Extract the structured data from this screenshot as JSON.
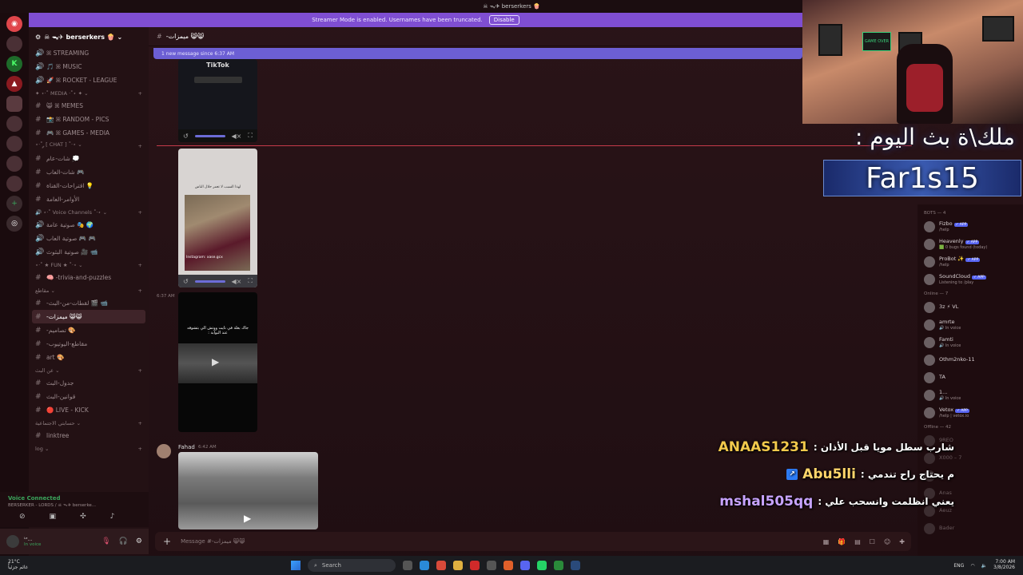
{
  "titlebar": {
    "server": "☠ ᯓ✈ berserkers 🍿"
  },
  "banner": {
    "text": "Streamer Mode is enabled. Usernames have been truncated.",
    "disable": "Disable"
  },
  "server_header": {
    "name": "☠ ᯓ✈ berserkers 🍿 ⌄"
  },
  "channels": [
    {
      "icon": "🔊",
      "label": "ꕤ STREAMING",
      "type": "voice"
    },
    {
      "icon": "🔊",
      "label": "🎵 ꕤ MUSIC",
      "type": "voice"
    },
    {
      "icon": "🔊",
      "label": "🚀 ꕤ ROCKET - LEAGUE",
      "type": "voice"
    },
    {
      "icon": "",
      "label": "✦ ⋆·˚ MEDIA ·˚⋆ ✦ ⌄",
      "type": "category"
    },
    {
      "icon": "#",
      "label": "😸 ꕤ MEMES",
      "type": "text"
    },
    {
      "icon": "#",
      "label": "📸 ꕤ RANDOM - PICS",
      "type": "text"
    },
    {
      "icon": "#",
      "label": "🎮 ꕤ GAMES - MEDIA",
      "type": "text"
    },
    {
      "icon": "",
      "label": "⋆·˚ ༘ [ CHAT ] ˚·⋆ ⌄",
      "type": "category"
    },
    {
      "icon": "#",
      "label": "شات-عام 💭",
      "type": "text"
    },
    {
      "icon": "#",
      "label": "شات-العاب 🎮",
      "type": "text"
    },
    {
      "icon": "#",
      "label": "اقتراحات-القناة 💡",
      "type": "text"
    },
    {
      "icon": "#",
      "label": "الأوامر-العامة",
      "type": "text"
    },
    {
      "icon": "",
      "label": "🔊 ⋆·˚ Voice Channels ˚·⋆ ⌄",
      "type": "category"
    },
    {
      "icon": "🔊",
      "label": "صوتية عامة 🎭 🌍",
      "type": "voice"
    },
    {
      "icon": "🔊",
      "label": "صوتية العاب 🎮 🎮",
      "type": "voice"
    },
    {
      "icon": "🔊",
      "label": "صوتية البثوث 🎥 📹",
      "type": "voice"
    },
    {
      "icon": "",
      "label": "⋆·˚ ★ FUN ★ ˚·⋆ ⌄",
      "type": "category"
    },
    {
      "icon": "#",
      "label": "🧠 -trivia-and-puzzles",
      "type": "text"
    },
    {
      "icon": "",
      "label": "مقاطع ⌄",
      "type": "category"
    },
    {
      "icon": "#",
      "label": "-لقطات-من-البث 🎬 📹",
      "type": "text"
    },
    {
      "icon": "#",
      "label": "-ميمزات 😸😸",
      "type": "text",
      "selected": true
    },
    {
      "icon": "#",
      "label": "-تصاميم 🎨",
      "type": "text"
    },
    {
      "icon": "#",
      "label": "-مقاطع-اليوتيوب",
      "type": "text"
    },
    {
      "icon": "#",
      "label": "art 🎨",
      "type": "text"
    },
    {
      "icon": "",
      "label": "عن البث ⌄",
      "type": "category"
    },
    {
      "icon": "#",
      "label": "جدول-البث",
      "type": "text"
    },
    {
      "icon": "#",
      "label": "قوانين-البث",
      "type": "text"
    },
    {
      "icon": "#",
      "label": "🔴 LIVE - KICK",
      "type": "text"
    },
    {
      "icon": "",
      "label": "حسابتي الاجتماعية ⌄",
      "type": "category"
    },
    {
      "icon": "#",
      "label": "linktree",
      "type": "text"
    },
    {
      "icon": "",
      "label": "log ⌄",
      "type": "category"
    }
  ],
  "voice": {
    "title": "Voice Connected",
    "sub": "BERSERKER - LORDS / ☠ ᯓ✈ berserke..."
  },
  "user": {
    "name": "ᴸᵉ...",
    "status": "In voice"
  },
  "chan_header": {
    "name": "-ميمزات 😸😸"
  },
  "new_messages": "1 new message since 6:37 AM",
  "messages": {
    "tiktok_label": "TikTok",
    "ts1": "6:37 AM",
    "card2_caption": "لهذا السبب لا تعمر حلال الناس",
    "card2_credit": "Instagram: xase.gcx",
    "card3_caption": "جاك بعلة في نايت ووتش الي بتشوفه عند البوابة :",
    "author": "Fahad",
    "author_time": "6:42 AM"
  },
  "input": {
    "placeholder": "Message #-ميمزات 😸😸"
  },
  "members": {
    "bots_header": "BOTS — 4",
    "bots": [
      {
        "name": "Fizbo",
        "sub": "/help",
        "tag": "✓ APP"
      },
      {
        "name": "Heavenly",
        "sub": "🟩 0 bugs found (today)",
        "tag": "✓ APP"
      },
      {
        "name": "ProBot ✨",
        "sub": "/help",
        "tag": "✓ APP"
      },
      {
        "name": "SoundCloud",
        "sub": "Listening to /play",
        "tag": "✓ APP"
      }
    ],
    "online_header": "Online — 7",
    "online": [
      {
        "name": "3z ⚡ VL",
        "sub": ""
      },
      {
        "name": "amrte",
        "sub": "🔊 In voice"
      },
      {
        "name": "Famti",
        "sub": "🔊 In voice"
      },
      {
        "name": "Othm2nko-11",
        "sub": ""
      },
      {
        "name": "TA",
        "sub": ""
      },
      {
        "name": "1...",
        "sub": "🔊 In voice"
      },
      {
        "name": "Vetox",
        "sub": "/help | vetox.io",
        "tag": "✓ APP"
      }
    ],
    "offline_header": "Offline — 42",
    "offline": [
      {
        "name": "9REO"
      },
      {
        "name": "X000 – 7"
      },
      {
        "name": "..."
      },
      {
        "name": "Anas"
      },
      {
        "name": "Aeuz"
      },
      {
        "name": "Bader"
      }
    ]
  },
  "overlay": {
    "queen_title": "ملك\\ة بث اليوم :",
    "queen_name": "Far1s15",
    "webcam_screen": "GAME OVER"
  },
  "chat": [
    {
      "user": "ANAAS1231",
      "msg": "شارب سطل مويا قبل الأذان :"
    },
    {
      "user": "Abu5lli",
      "msg": "م يحتاج راح تندمي :"
    },
    {
      "user": "mshal505qq",
      "msg": "يعني انظلمت وانسحب علي :"
    }
  ],
  "taskbar": {
    "temp": "21°C",
    "weather": "غائم جزئياً",
    "search": "Search",
    "lang": "ENG",
    "time": "7:00 AM",
    "date": "3/8/2026"
  }
}
